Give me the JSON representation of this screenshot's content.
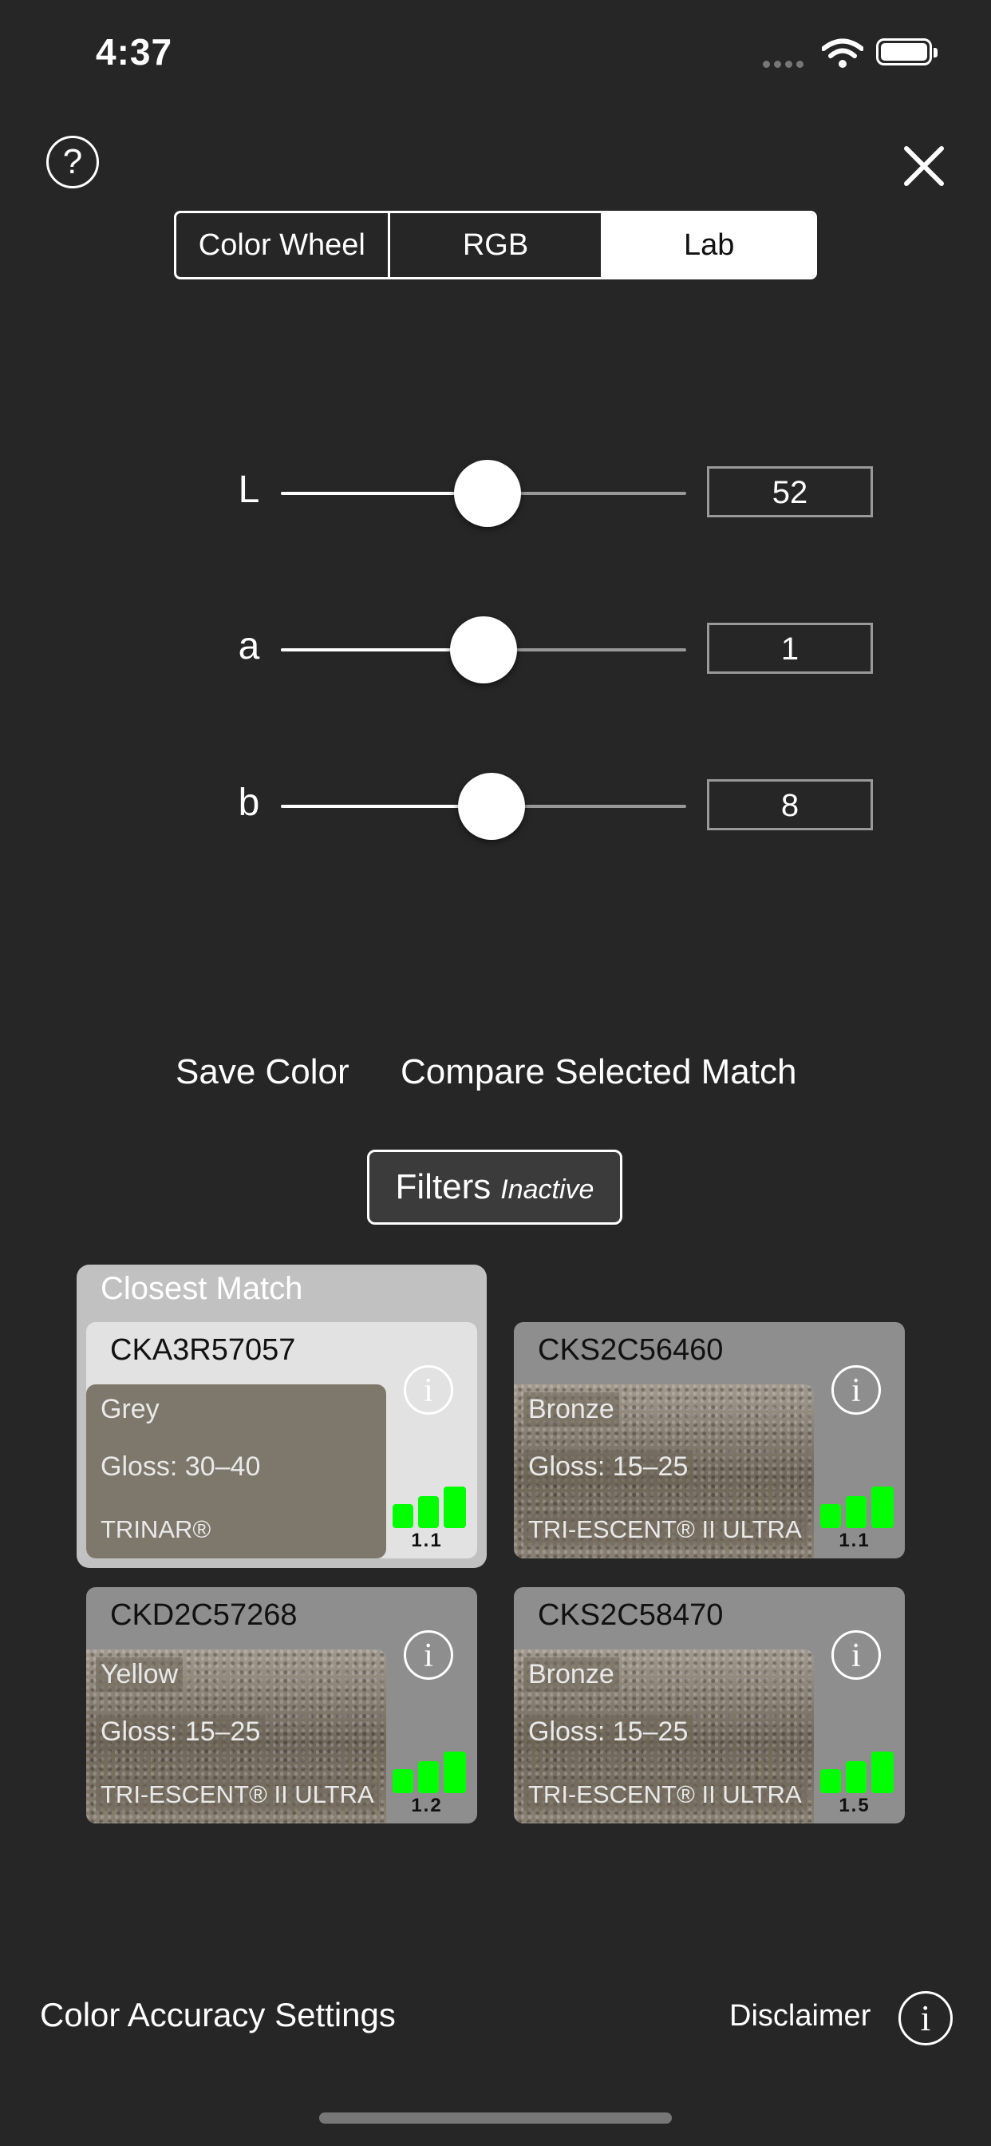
{
  "status_bar": {
    "time": "4:37"
  },
  "header": {
    "help_glyph": "?",
    "icons": {
      "help": "question-circle-icon",
      "close": "close-icon"
    }
  },
  "mode_tabs": [
    {
      "label": "Color Wheel",
      "active": false
    },
    {
      "label": "RGB",
      "active": false
    },
    {
      "label": "Lab",
      "active": true
    }
  ],
  "sliders": [
    {
      "label": "L",
      "value": "52",
      "position": 0.51
    },
    {
      "label": "a",
      "value": "1",
      "position": 0.5
    },
    {
      "label": "b",
      "value": "8",
      "position": 0.52
    }
  ],
  "actions": {
    "save": "Save Color",
    "compare": "Compare Selected Match"
  },
  "filters": {
    "label": "Filters",
    "status": "Inactive"
  },
  "closest_match_title": "Closest Match",
  "matches": [
    {
      "code": "CKA3R57057",
      "color": "Grey",
      "gloss": "Gloss: 30–40",
      "product": "TRINAR®",
      "score": "1.1",
      "finish": "solid"
    },
    {
      "code": "CKS2C56460",
      "color": "Bronze",
      "gloss": "Gloss: 15–25",
      "product": "TRI-ESCENT® II ULTRA",
      "score": "1.1",
      "finish": "metallic"
    },
    {
      "code": "CKD2C57268",
      "color": "Yellow",
      "gloss": "Gloss: 15–25",
      "product": "TRI-ESCENT® II ULTRA",
      "score": "1.2",
      "finish": "metallic"
    },
    {
      "code": "CKS2C58470",
      "color": "Bronze",
      "gloss": "Gloss: 15–25",
      "product": "TRI-ESCENT® II ULTRA",
      "score": "1.5",
      "finish": "metallic"
    }
  ],
  "info_glyph": "i",
  "footer": {
    "settings": "Color Accuracy Settings",
    "disclaimer": "Disclaimer"
  },
  "colors": {
    "background": "#262626",
    "match_bars": "#00ff00",
    "closest_frame": "#c1c1c1"
  }
}
